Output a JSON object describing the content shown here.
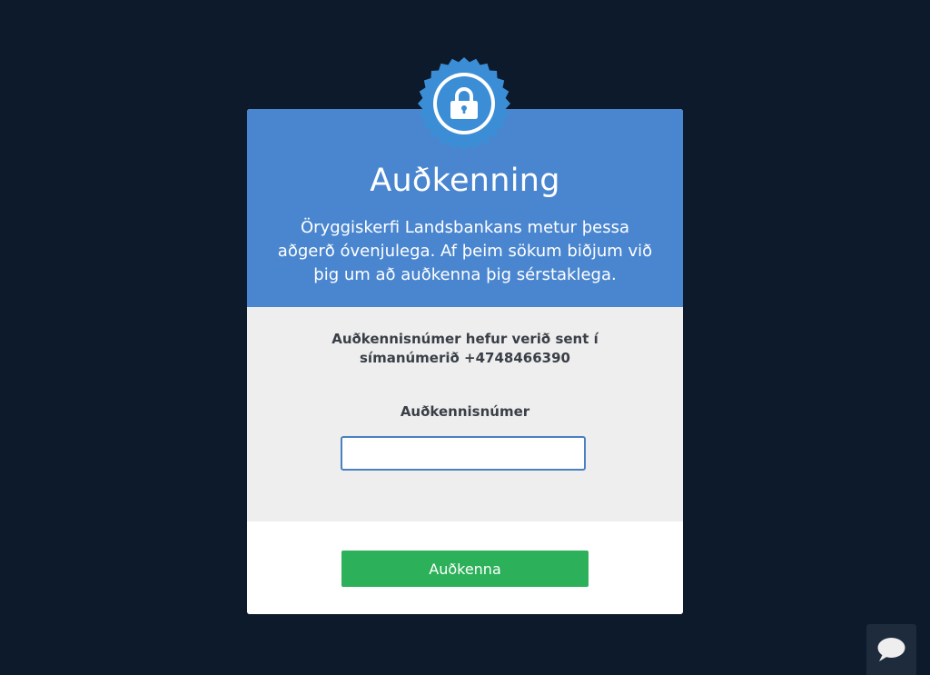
{
  "auth_modal": {
    "title": "Auðkenning",
    "description": "Öryggiskerfi Landsbankans metur þessa aðgerð óvenjulega. Af þeim sökum biðjum við þig um að auðkenna þig sérstaklega.",
    "sent_message": "Auðkennisnúmer hefur verið sent í símanúmerið +4748466390",
    "code_field": {
      "label": "Auðkennisnúmer",
      "value": "",
      "placeholder": ""
    },
    "submit_label": "Auðkenna"
  },
  "icons": {
    "badge": "lock-icon",
    "chat": "chat-icon"
  },
  "colors": {
    "page_background": "#0d1a2b",
    "header_blue": "#4a86d0",
    "badge_blue": "#3b8ed6",
    "body_gray": "#eeeeee",
    "submit_green": "#2cb059",
    "chat_widget": "#1e2b3d"
  }
}
